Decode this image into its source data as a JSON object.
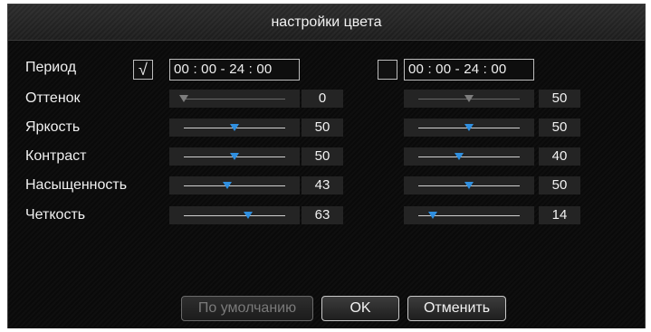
{
  "dialog": {
    "title": "настройки цвета"
  },
  "period": {
    "label": "Период",
    "left": {
      "checked": true,
      "check_glyph": "√",
      "time": "00 : 00 - 24 : 00"
    },
    "right": {
      "checked": false,
      "check_glyph": "",
      "time": "00 : 00 - 24 : 00"
    }
  },
  "rows": [
    {
      "label": "Оттенок",
      "left": {
        "value": "0",
        "fraction": 0.0,
        "disabled": true
      },
      "right": {
        "value": "50",
        "fraction": 0.5,
        "disabled": true
      }
    },
    {
      "label": "Яркость",
      "left": {
        "value": "50",
        "fraction": 0.5,
        "disabled": false
      },
      "right": {
        "value": "50",
        "fraction": 0.5,
        "disabled": false
      }
    },
    {
      "label": "Контраст",
      "left": {
        "value": "50",
        "fraction": 0.5,
        "disabled": false
      },
      "right": {
        "value": "40",
        "fraction": 0.4,
        "disabled": false
      }
    },
    {
      "label": "Насыщенность",
      "left": {
        "value": "43",
        "fraction": 0.43,
        "disabled": false
      },
      "right": {
        "value": "50",
        "fraction": 0.5,
        "disabled": false
      }
    },
    {
      "label": "Четкость",
      "left": {
        "value": "63",
        "fraction": 0.63,
        "disabled": false
      },
      "right": {
        "value": "14",
        "fraction": 0.14,
        "disabled": false
      }
    }
  ],
  "buttons": {
    "default_label": "По умолчанию",
    "ok_label": "OK",
    "cancel_label": "Отменить"
  },
  "colors": {
    "accent": "#2f8fe0",
    "background": "#0b0b0b"
  }
}
